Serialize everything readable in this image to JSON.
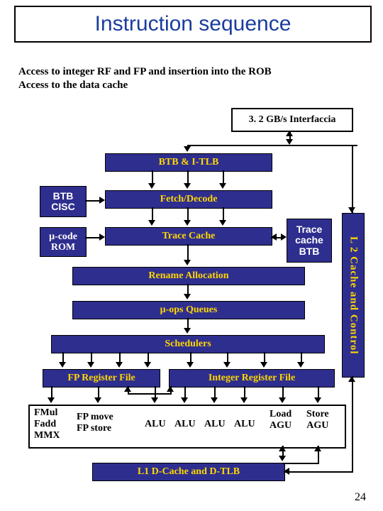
{
  "title": "Instruction sequence",
  "subtitle_line1": "Access to integer RF  and  FP and insertion into the  ROB",
  "subtitle_line2": "Access to the data cache",
  "interfaccia": "3. 2 GB/s Interfaccia",
  "blocks": {
    "btb_itlb": "BTB & I-TLB",
    "btb_cisc_l1": "BTB",
    "btb_cisc_l2": "CISC",
    "fetch_decode": "Fetch/Decode",
    "ucode_l1": "μ-code",
    "ucode_l2": "ROM",
    "trace_cache": "Trace Cache",
    "trace_btb_l1": "Trace",
    "trace_btb_l2": "cache",
    "trace_btb_l3": "BTB",
    "rename": "Rename Allocation",
    "uops_queues": "μ-ops Queues",
    "schedulers": "Schedulers",
    "fp_rf": "FP Register File",
    "int_rf": "Integer Register File",
    "l1d": "L1 D-Cache and D-TLB",
    "l2": "L 2 Cache and Control"
  },
  "exec": {
    "col1_l1": "FMul",
    "col1_l2": "Fadd",
    "col1_l3": "MMX",
    "col2_l1": "FP move",
    "col2_l2": "FP store",
    "alu": "ALU",
    "load": "Load",
    "store": "Store",
    "agu": "AGU"
  },
  "page_number": "24"
}
